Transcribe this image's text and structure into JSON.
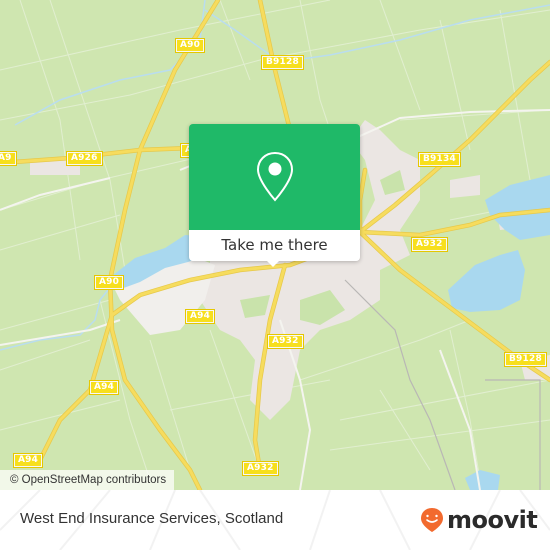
{
  "map": {
    "attribution": "© OpenStreetMap contributors",
    "colors": {
      "land": "#cfe6b0",
      "urban": "#ebe6e3",
      "water": "#a9d8ef",
      "road_major": "#f6dc5e",
      "popup_green": "#1fb968"
    },
    "road_labels": [
      {
        "id": "a90-north",
        "text": "A90"
      },
      {
        "id": "b9128-north",
        "text": "B9128"
      },
      {
        "id": "a926-west-edge",
        "text": "A9"
      },
      {
        "id": "a926",
        "text": "A926"
      },
      {
        "id": "a9-center",
        "text": "A9"
      },
      {
        "id": "b9134",
        "text": "B9134"
      },
      {
        "id": "a932-east",
        "text": "A932"
      },
      {
        "id": "a90-south",
        "text": "A90"
      },
      {
        "id": "a94-center",
        "text": "A94"
      },
      {
        "id": "a932-center",
        "text": "A932"
      },
      {
        "id": "b9128-east",
        "text": "B9128"
      },
      {
        "id": "a94-west",
        "text": "A94"
      },
      {
        "id": "a94-southwest",
        "text": "A94"
      },
      {
        "id": "a932-south",
        "text": "A932"
      }
    ]
  },
  "popup": {
    "icon": "location-pin-icon",
    "button_label": "Take me there"
  },
  "footer": {
    "place_name": "West End Insurance Services, Scotland",
    "brand": "moovit",
    "brand_color": "#f26a2e"
  }
}
